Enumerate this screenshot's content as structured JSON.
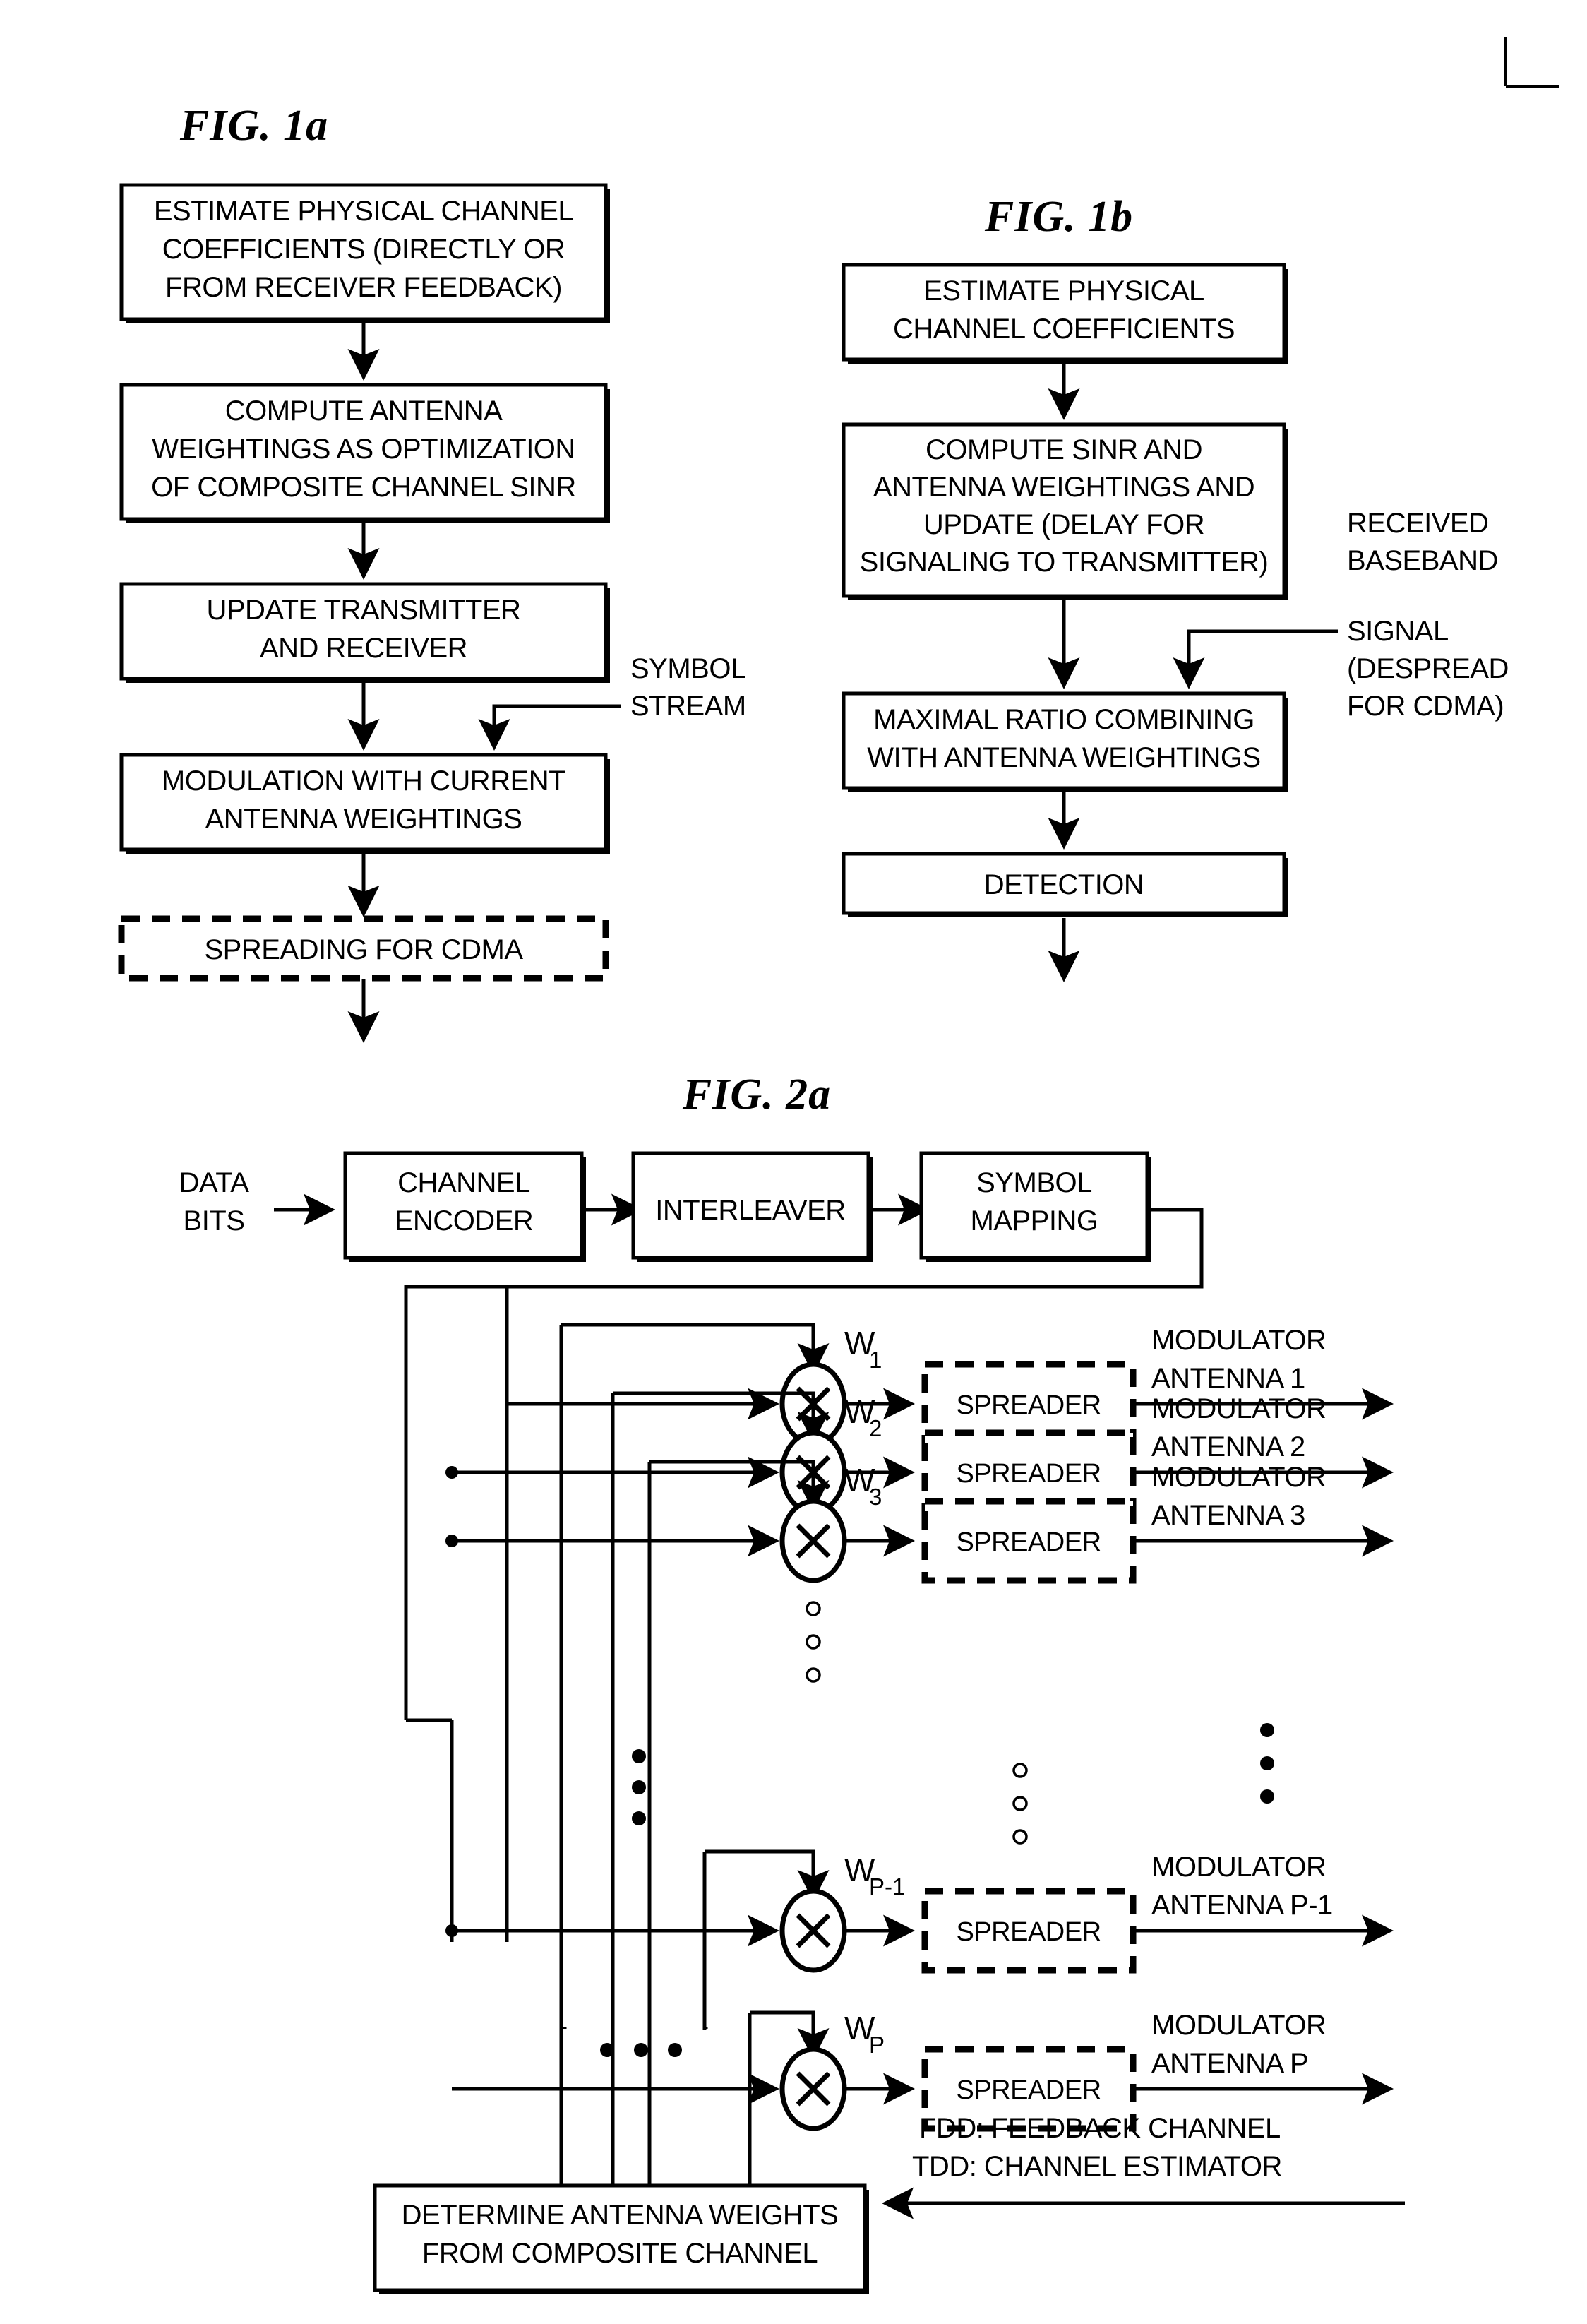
{
  "page": {
    "background": "#ffffff",
    "ink": "#000000",
    "corner_mark": "registration-corner-mark"
  },
  "fig1a": {
    "title": "FIG. 1a",
    "boxes": [
      {
        "id": "estimate",
        "lines": [
          "ESTIMATE PHYSICAL CHANNEL",
          "COEFFICIENTS (DIRECTLY OR",
          "FROM RECEIVER FEEDBACK)"
        ],
        "style": "solid"
      },
      {
        "id": "compute",
        "lines": [
          "COMPUTE ANTENNA",
          "WEIGHTINGS AS OPTIMIZATION",
          "OF COMPOSITE CHANNEL SINR"
        ],
        "style": "solid"
      },
      {
        "id": "update",
        "lines": [
          "UPDATE TRANSMITTER",
          "AND RECEIVER"
        ],
        "style": "solid"
      },
      {
        "id": "modulation",
        "lines": [
          "MODULATION WITH CURRENT",
          "ANTENNA WEIGHTINGS"
        ],
        "style": "solid"
      },
      {
        "id": "spreading",
        "lines": [
          "SPREADING FOR CDMA"
        ],
        "style": "dashed"
      }
    ],
    "annotation": {
      "id": "symbol-stream",
      "lines": [
        "SYMBOL",
        "STREAM"
      ]
    }
  },
  "fig1b": {
    "title": "FIG. 1b",
    "boxes": [
      {
        "id": "estimate",
        "lines": [
          "ESTIMATE PHYSICAL",
          "CHANNEL COEFFICIENTS"
        ],
        "style": "solid"
      },
      {
        "id": "compute",
        "lines": [
          "COMPUTE SINR AND",
          "ANTENNA WEIGHTINGS AND",
          "UPDATE (DELAY FOR",
          "SIGNALING TO TRANSMITTER)"
        ],
        "style": "solid"
      },
      {
        "id": "mrc",
        "lines": [
          "MAXIMAL RATIO COMBINING",
          "WITH ANTENNA WEIGHTINGS"
        ],
        "style": "solid"
      },
      {
        "id": "detection",
        "lines": [
          "DETECTION"
        ],
        "style": "solid"
      }
    ],
    "annotation": {
      "id": "received-baseband-signal",
      "lines": [
        "RECEIVED",
        "BASEBAND",
        "SIGNAL",
        "(DESPREAD",
        "FOR CDMA)"
      ]
    }
  },
  "fig2a": {
    "title": "FIG. 2a",
    "input_label": {
      "lines": [
        "DATA",
        "BITS"
      ]
    },
    "chain": [
      {
        "id": "channel-encoder",
        "lines": [
          "CHANNEL",
          "ENCODER"
        ]
      },
      {
        "id": "interleaver",
        "lines": [
          "INTERLEAVER"
        ]
      },
      {
        "id": "symbol-mapping",
        "lines": [
          "SYMBOL",
          "MAPPING"
        ]
      }
    ],
    "spreader_label": "SPREADER",
    "branches": [
      {
        "id": "branch-1",
        "weight_base": "W",
        "weight_sub": "1",
        "out_lines": [
          "MODULATOR",
          "ANTENNA 1"
        ]
      },
      {
        "id": "branch-2",
        "weight_base": "W",
        "weight_sub": "2",
        "out_lines": [
          "MODULATOR",
          "ANTENNA 2"
        ]
      },
      {
        "id": "branch-3",
        "weight_base": "W",
        "weight_sub": "3",
        "out_lines": [
          "MODULATOR",
          "ANTENNA 3"
        ]
      },
      {
        "id": "branch-p-minus-1",
        "weight_base": "W",
        "weight_sub": "P-1",
        "out_lines": [
          "MODULATOR",
          "ANTENNA P-1"
        ]
      },
      {
        "id": "branch-p",
        "weight_base": "W",
        "weight_sub": "P",
        "out_lines": [
          "MODULATOR",
          "ANTENNA P"
        ]
      }
    ],
    "feedback_lines": [
      "FDD: FEEDBACK CHANNEL",
      "TDD: CHANNEL ESTIMATOR"
    ],
    "determine_box": {
      "id": "determine-antenna-weights",
      "lines": [
        "DETERMINE ANTENNA WEIGHTS",
        "FROM COMPOSITE CHANNEL"
      ]
    },
    "ellipsis": {
      "vertical": "three-dots",
      "horizontal": "three-dots"
    }
  }
}
